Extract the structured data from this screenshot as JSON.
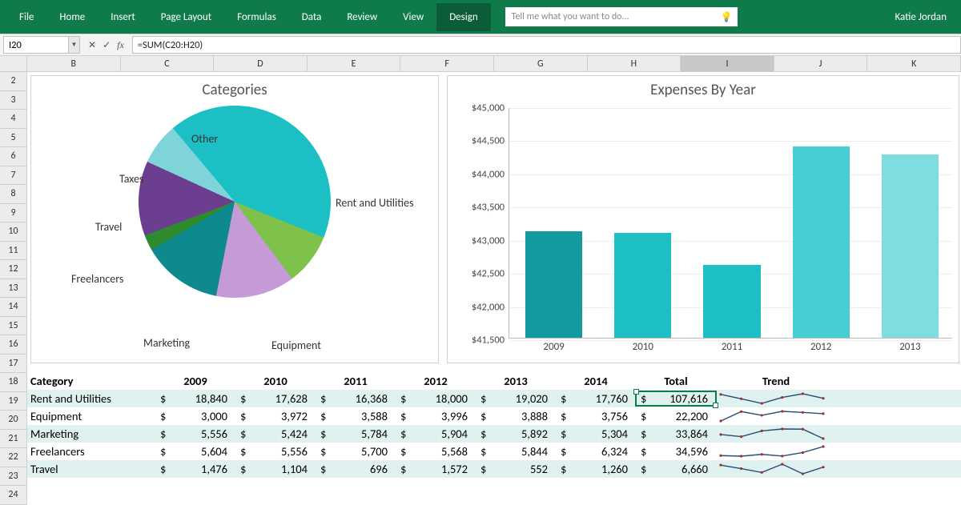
{
  "ribbon": {
    "tabs": [
      "File",
      "Home",
      "Insert",
      "Page Layout",
      "Formulas",
      "Data",
      "Review",
      "View",
      "Design"
    ],
    "active": "Design",
    "tellme_placeholder": "Tell me what you want to do...",
    "user": "Katie Jordan"
  },
  "formula_bar": {
    "namebox": "I20",
    "formula": "=SUM(C20:H20)"
  },
  "columns": [
    "B",
    "C",
    "D",
    "E",
    "F",
    "G",
    "H",
    "I",
    "J",
    "K"
  ],
  "selected_col": "I",
  "rows": [
    2,
    3,
    4,
    5,
    6,
    7,
    8,
    9,
    10,
    11,
    12,
    13,
    14,
    15,
    16,
    17,
    18,
    19,
    20,
    21,
    22,
    23,
    24
  ],
  "table": {
    "headers": [
      "Category",
      "2009",
      "2010",
      "2011",
      "2012",
      "2013",
      "2014",
      "Total",
      "Trend"
    ],
    "rows": [
      {
        "cat": "Rent and Utilities",
        "vals": [
          18840,
          17628,
          16368,
          18000,
          19020,
          17760
        ],
        "total": 107616,
        "band": true,
        "selected_total": true
      },
      {
        "cat": "Equipment",
        "vals": [
          3000,
          3972,
          3588,
          3996,
          3888,
          3756
        ],
        "total": 22200,
        "band": false
      },
      {
        "cat": "Marketing",
        "vals": [
          5556,
          5424,
          5784,
          5904,
          5892,
          5304
        ],
        "total": 33864,
        "band": true
      },
      {
        "cat": "Freelancers",
        "vals": [
          5604,
          5556,
          5700,
          5568,
          5844,
          6324
        ],
        "total": 34596,
        "band": false
      },
      {
        "cat": "Travel",
        "vals": [
          1476,
          1104,
          696,
          1572,
          552,
          1260
        ],
        "total": 6660,
        "band": true
      }
    ]
  },
  "chart_data": [
    {
      "type": "pie",
      "title": "Categories",
      "series": [
        {
          "name": "Rent and Utilities",
          "value": 107616,
          "color": "#1bbfc4"
        },
        {
          "name": "Equipment",
          "value": 22200,
          "color": "#7fc24b"
        },
        {
          "name": "Marketing",
          "value": 33864,
          "color": "#c49bd6"
        },
        {
          "name": "Freelancers",
          "value": 34596,
          "color": "#0e8a8f"
        },
        {
          "name": "Travel",
          "value": 6660,
          "color": "#2e8b2e"
        },
        {
          "name": "Taxes",
          "value": 32000,
          "color": "#6b3e8f"
        },
        {
          "name": "Other",
          "value": 18000,
          "color": "#7fd4d9"
        }
      ]
    },
    {
      "type": "bar",
      "title": "Expenses By Year",
      "categories": [
        "2009",
        "2010",
        "2011",
        "2012",
        "2013"
      ],
      "values": [
        43100,
        43080,
        42600,
        44380,
        44260
      ],
      "ylim": [
        41500,
        45000
      ],
      "yticks": [
        41500,
        42000,
        42500,
        43000,
        43500,
        44000,
        44500,
        45000
      ],
      "ytick_labels": [
        "$41,500",
        "$42,000",
        "$42,500",
        "$43,000",
        "$43,500",
        "$44,000",
        "$44,500",
        "$45,000"
      ],
      "colors": [
        "#139aa0",
        "#1bbfc4",
        "#1bbfc4",
        "#46cfd3",
        "#7fdce0"
      ]
    }
  ]
}
